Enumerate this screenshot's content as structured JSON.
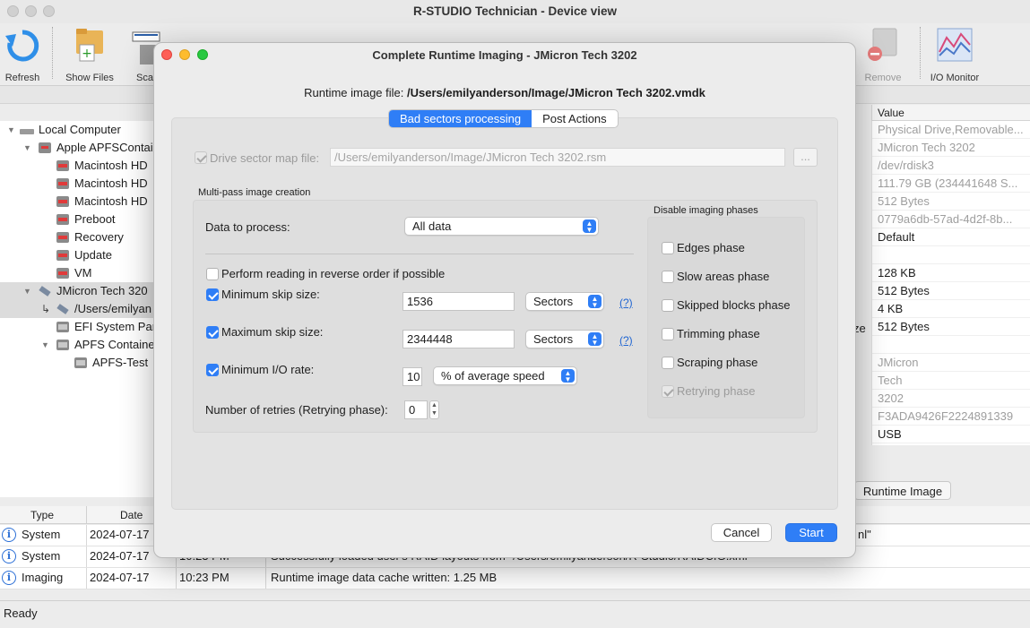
{
  "window": {
    "title": "R-STUDIO Technician - Device view"
  },
  "toolbar": {
    "refresh": "Refresh",
    "show_files": "Show Files",
    "scan": "Sca",
    "remove": "Remove",
    "io_monitor": "I/O Monitor"
  },
  "tree": {
    "items": [
      {
        "label": "Local Computer"
      },
      {
        "label": "Apple APFSContai"
      },
      {
        "label": "Macintosh HD"
      },
      {
        "label": "Macintosh HD"
      },
      {
        "label": "Macintosh HD"
      },
      {
        "label": "Preboot"
      },
      {
        "label": "Recovery"
      },
      {
        "label": "Update"
      },
      {
        "label": "VM"
      },
      {
        "label": "JMicron Tech 320"
      },
      {
        "label": "/Users/emilyan"
      },
      {
        "label": "EFI System Par"
      },
      {
        "label": "APFS Containe"
      },
      {
        "label": "APFS-Test"
      }
    ]
  },
  "properties": {
    "header": "Value",
    "size_fragment": "ze",
    "values": [
      "Physical Drive,Removable...",
      "JMicron Tech 3202",
      "/dev/rdisk3",
      "111.79 GB (234441648 S...",
      "512 Bytes",
      "0779a6db-57ad-4d2f-8b...",
      "Default",
      "",
      "128 KB",
      "512 Bytes",
      "4 KB",
      "512 Bytes",
      "",
      "JMicron",
      "Tech",
      "3202",
      "F3ADA9426F2224891339",
      "USB"
    ],
    "runtime_tab": "Runtime Image"
  },
  "log": {
    "headers": {
      "type": "Type",
      "date": "Date"
    },
    "rows": [
      {
        "type": "System",
        "date": "2024-07-17",
        "time": "",
        "message": "nl\""
      },
      {
        "type": "System",
        "date": "2024-07-17",
        "time": "10:23 PM",
        "message": "Successfully loaded user's RAID layouts from \"/Users/emilyanderson/R-Studio/RAIDCfG.xml\""
      },
      {
        "type": "Imaging",
        "date": "2024-07-17",
        "time": "10:23 PM",
        "message": "Runtime image data cache written: 1.25 MB"
      }
    ]
  },
  "statusbar": {
    "text": "Ready"
  },
  "dialog": {
    "title": "Complete Runtime Imaging - JMicron Tech 3202",
    "runtime_label": "Runtime image file:",
    "runtime_path": "/Users/emilyanderson/Image/JMicron Tech 3202.vmdk",
    "tabs": [
      "Bad sectors processing",
      "Post Actions"
    ],
    "drive_map_label": "Drive sector map file:",
    "drive_map_value": "/Users/emilyanderson/Image/JMicron Tech 3202.rsm",
    "browse_label": "...",
    "multipass_title": "Multi-pass image creation",
    "data_to_process_label": "Data to process:",
    "data_to_process_value": "All data",
    "reverse_label": "Perform reading in reverse order if possible",
    "min_skip_label": "Minimum skip size:",
    "min_skip_value": "1536",
    "min_skip_unit": "Sectors",
    "max_skip_label": "Maximum skip size:",
    "max_skip_value": "2344448",
    "max_skip_unit": "Sectors",
    "help_label": "(?)",
    "min_io_label": "Minimum I/O rate:",
    "min_io_value": "10",
    "min_io_unit": "% of average speed",
    "retries_label": "Number of retries (Retrying phase):",
    "retries_value": "0",
    "phases_title": "Disable imaging phases",
    "phases": [
      "Edges phase",
      "Slow areas phase",
      "Skipped blocks phase",
      "Trimming phase",
      "Scraping phase",
      "Retrying phase"
    ],
    "cancel": "Cancel",
    "start": "Start"
  },
  "colors": {
    "accent": "#2f7ef6",
    "close": "#fe5f57",
    "minimize": "#febc2e",
    "zoom": "#28c840"
  }
}
